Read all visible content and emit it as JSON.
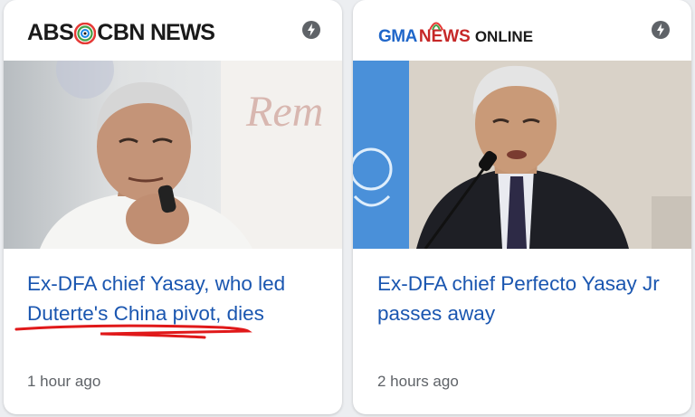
{
  "cards": [
    {
      "source_logo": {
        "part1": "ABS",
        "part2": "CBN",
        "part3": "NEWS"
      },
      "headline": "Ex-DFA chief Yasay, who led Duterte's China pivot, dies",
      "timestamp": "1 hour ago",
      "photo_caption_text": "Rem",
      "badge_icon": "amp-bolt-icon"
    },
    {
      "source_logo": {
        "part1": "GMA",
        "part2": "NEWS",
        "part3": "ONLINE"
      },
      "headline": "Ex-DFA chief Perfecto Yasay Jr passes away",
      "timestamp": "2 hours ago",
      "badge_icon": "amp-bolt-icon"
    }
  ],
  "colors": {
    "headline": "#1a56b0",
    "timestamp": "#5f6368",
    "annotation": "#e0191a",
    "gma_blue": "#1f66c9",
    "gma_red": "#c62828"
  }
}
